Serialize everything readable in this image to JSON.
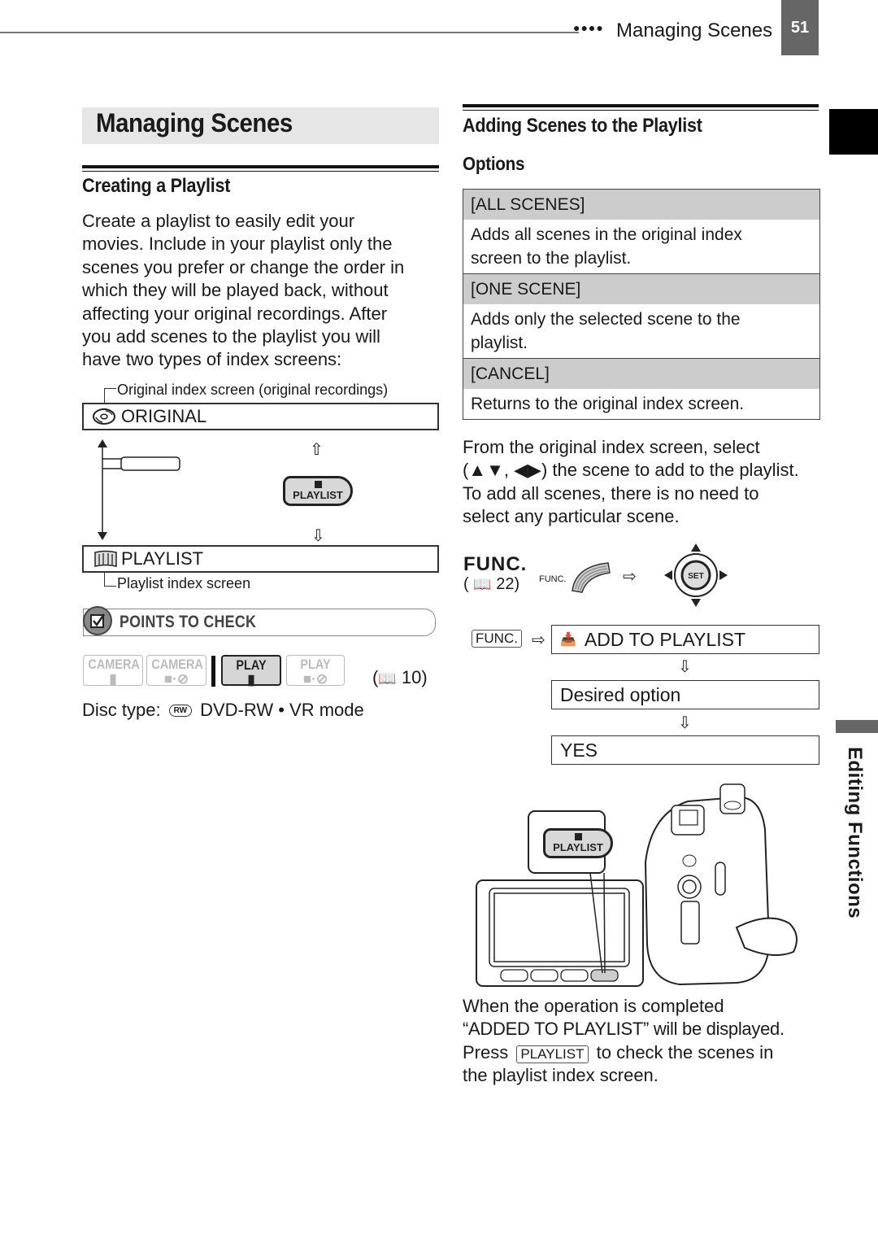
{
  "header": {
    "dots": "●●●●",
    "section_title": "Managing Scenes",
    "page_number": "51"
  },
  "side_tab": {
    "chapter": "Editing Functions"
  },
  "left": {
    "main_title": "Managing Scenes",
    "subheading": "Creating a Playlist",
    "intro": "Create a playlist to easily edit your movies. Include in your playlist only the scenes you prefer or change the order in which they will be played back, without affecting your original recordings. After you add scenes to the playlist you will have two types of index screens:",
    "intro_lines": [
      "Create a playlist to easily edit your",
      "movies. Include in your playlist only the",
      "scenes you prefer or change the order in",
      "which they will be played back, without",
      "affecting your original recordings. After",
      "you add scenes to the playlist you will",
      "have two types of index screens:"
    ],
    "diagram": {
      "original_caption": "Original index screen (original recordings)",
      "original_label": "ORIGINAL",
      "original_icon": "disc-icon",
      "playlist_label": "PLAYLIST",
      "playlist_icon": "film-icon",
      "playlist_caption": "Playlist index screen",
      "button_label": "PLAYLIST",
      "up_arrow": "⇧",
      "down_arrow": "⇩"
    },
    "points_to_check": {
      "label": "POINTS TO CHECK",
      "modes": [
        {
          "label": "CAMERA",
          "sub": "movie",
          "active": false
        },
        {
          "label": "CAMERA",
          "sub": "photo",
          "active": false
        },
        {
          "label": "PLAY",
          "sub": "movie",
          "active": true
        },
        {
          "label": "PLAY",
          "sub": "photo",
          "active": false
        }
      ],
      "page_ref": "10",
      "disc_type_label": "Disc type:",
      "disc_badge": "RW",
      "disc_type_value": "DVD-RW • VR mode"
    }
  },
  "right": {
    "subheading": "Adding Scenes to the Playlist",
    "options_heading": "Options",
    "options": [
      {
        "name": "[ALL SCENES]",
        "desc_lines": [
          "Adds all scenes in the original index",
          "screen to the playlist."
        ]
      },
      {
        "name": "[ONE SCENE]",
        "desc_lines": [
          "Adds only the selected scene to the",
          "playlist."
        ]
      },
      {
        "name": "[CANCEL]",
        "desc_lines": [
          "Returns to the original index screen."
        ]
      }
    ],
    "instruction_lines": [
      "From the original index screen, select",
      "(▲▼, ◀▶) the scene to add to the playlist.",
      "To add all scenes, there is no need to",
      "select any particular scene."
    ],
    "func": {
      "label": "FUNC.",
      "page_ref": "22",
      "small_label": "FUNC.",
      "set_label": "SET"
    },
    "flow": {
      "key": "FUNC.",
      "steps": [
        "ADD TO PLAYLIST",
        "Desired option",
        "YES"
      ],
      "arrow_right": "⇨",
      "arrow_down": "⇩"
    },
    "camera_button_label": "PLAYLIST",
    "completion_lines": [
      "When the operation is completed",
      "“ADDED TO PLAYLIST” will be displayed.",
      "to check the scenes in",
      "the playlist index screen."
    ],
    "press_word": "Press",
    "press_key": "PLAYLIST"
  }
}
